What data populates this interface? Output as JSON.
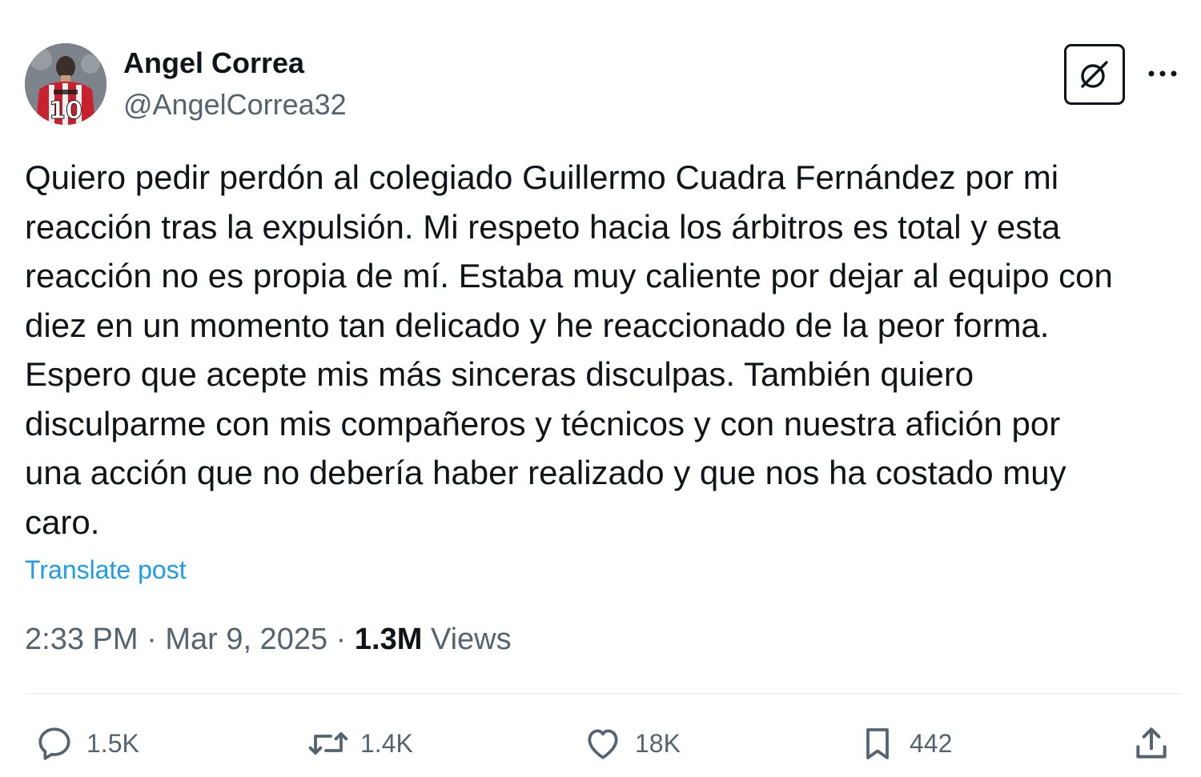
{
  "author": {
    "display_name": "Angel Correa",
    "handle": "@AngelCorrea32",
    "avatar_jersey_number": "10"
  },
  "post": {
    "lines": [
      "Quiero pedir perdón al colegiado Guillermo Cuadra Fernández por mi",
      "reacción tras la expulsión. Mi respeto hacia los árbitros es total y esta",
      "reacción no es propia de mí. Estaba muy caliente por dejar al equipo con",
      "diez en un momento tan delicado y he reaccionado de la peor forma.",
      "Espero que acepte mis más sinceras disculpas. También quiero",
      "disculparme con mis compañeros y técnicos y con nuestra afición por",
      "una acción que no debería haber realizado y que nos ha costado muy",
      "caro."
    ],
    "translate_label": "Translate post"
  },
  "meta": {
    "time": "2:33 PM",
    "date": "Mar 9, 2025",
    "separator": "·",
    "views_count": "1.3M",
    "views_label": "Views"
  },
  "actions": {
    "replies": "1.5K",
    "reposts": "1.4K",
    "likes": "18K",
    "bookmarks": "442"
  },
  "icons": {
    "grok": "grok-icon",
    "more": "more-icon",
    "reply": "reply-icon",
    "repost": "repost-icon",
    "like": "heart-icon",
    "bookmark": "bookmark-icon",
    "share": "share-icon"
  },
  "colors": {
    "text": "#0f1419",
    "secondary": "#536471",
    "link": "#1d9bf0",
    "divider": "#eff3f4",
    "jersey_red": "#c8202f"
  }
}
